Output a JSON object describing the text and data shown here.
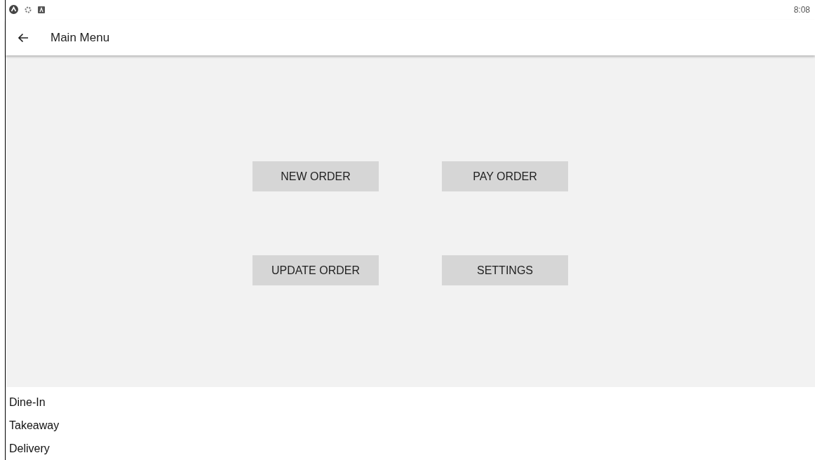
{
  "status_bar": {
    "time": "8:08"
  },
  "app_bar": {
    "title": "Main Menu"
  },
  "buttons": [
    "NEW ORDER",
    "PAY ORDER",
    "UPDATE ORDER",
    "SETTINGS"
  ],
  "list_items": [
    "Dine-In",
    "Takeaway",
    "Delivery"
  ]
}
